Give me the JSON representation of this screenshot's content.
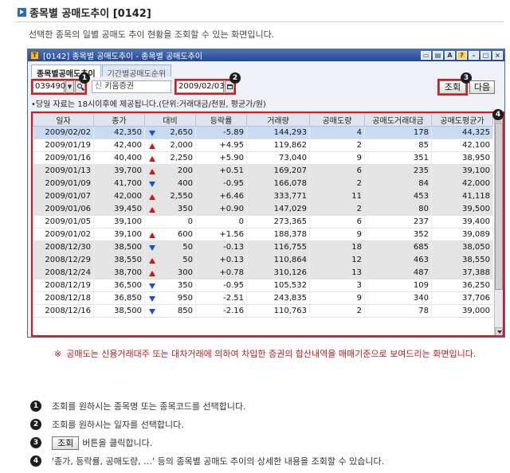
{
  "page": {
    "title": "종목별 공매도추이 [0142]",
    "description": "선택한 종목의 일별 공매도 추이 현황을 조회할 수 있는 화면입니다."
  },
  "window": {
    "app_icon": "T",
    "title": "[0142] 종목별 공매도추이 - 종목별 공매도추이",
    "titlebar_buttons": [
      "window-icon",
      "print-icon",
      "A",
      "?",
      "minimize-icon",
      "maximize-icon",
      "close-icon"
    ]
  },
  "tabs": [
    {
      "label": "종목별공매도추이",
      "active": true
    },
    {
      "label": "기간별공매도순위",
      "active": false
    }
  ],
  "query": {
    "code": "039490",
    "name_prefix": "신",
    "name": "키움증권",
    "date": "2009/02/03",
    "search_label": "조회",
    "next_label": "다음"
  },
  "badges": {
    "b1": "1",
    "b2": "2",
    "b3": "3",
    "b4": "4"
  },
  "notice": "•당일 자료는 18시이후에 제공됩니다.(단위:거래대금/천원, 평균가/원)",
  "table": {
    "headers": [
      "일자",
      "종가",
      "대비",
      "등락률",
      "거래량",
      "공매도량",
      "공매도거래대금",
      "공매도평균가"
    ],
    "rows": [
      {
        "date": "2009/02/02",
        "close": "42,350",
        "dir": "down",
        "change": "2,650",
        "rate": "-5.89",
        "volume": "144,293",
        "short_qty": "4",
        "short_amt": "178",
        "short_avg": "44,325"
      },
      {
        "date": "2009/01/19",
        "close": "42,400",
        "dir": "up",
        "change": "2,000",
        "rate": "+4.95",
        "volume": "119,862",
        "short_qty": "2",
        "short_amt": "85",
        "short_avg": "42,100"
      },
      {
        "date": "2009/01/16",
        "close": "40,400",
        "dir": "up",
        "change": "2,250",
        "rate": "+5.90",
        "volume": "73,040",
        "short_qty": "9",
        "short_amt": "351",
        "short_avg": "38,950"
      },
      {
        "date": "2009/01/13",
        "close": "39,700",
        "dir": "up",
        "change": "200",
        "rate": "+0.51",
        "volume": "169,207",
        "short_qty": "6",
        "short_amt": "235",
        "short_avg": "39,100"
      },
      {
        "date": "2009/01/09",
        "close": "41,700",
        "dir": "down",
        "change": "400",
        "rate": "-0.95",
        "volume": "166,078",
        "short_qty": "2",
        "short_amt": "84",
        "short_avg": "42,000"
      },
      {
        "date": "2009/01/07",
        "close": "42,000",
        "dir": "up",
        "change": "2,550",
        "rate": "+6.46",
        "volume": "333,771",
        "short_qty": "11",
        "short_amt": "453",
        "short_avg": "41,118"
      },
      {
        "date": "2009/01/06",
        "close": "39,450",
        "dir": "up",
        "change": "350",
        "rate": "+0.90",
        "volume": "147,029",
        "short_qty": "2",
        "short_amt": "80",
        "short_avg": "39,500"
      },
      {
        "date": "2009/01/05",
        "close": "39,100",
        "dir": "none",
        "change": "0",
        "rate": "0",
        "volume": "273,365",
        "short_qty": "6",
        "short_amt": "237",
        "short_avg": "39,400"
      },
      {
        "date": "2009/01/02",
        "close": "39,100",
        "dir": "up",
        "change": "600",
        "rate": "+1.56",
        "volume": "188,378",
        "short_qty": "9",
        "short_amt": "352",
        "short_avg": "39,089"
      },
      {
        "date": "2008/12/30",
        "close": "38,500",
        "dir": "down",
        "change": "50",
        "rate": "-0.13",
        "volume": "116,755",
        "short_qty": "18",
        "short_amt": "685",
        "short_avg": "38,050"
      },
      {
        "date": "2008/12/29",
        "close": "38,550",
        "dir": "up",
        "change": "50",
        "rate": "+0.13",
        "volume": "110,864",
        "short_qty": "12",
        "short_amt": "463",
        "short_avg": "38,550"
      },
      {
        "date": "2008/12/24",
        "close": "38,700",
        "dir": "up",
        "change": "300",
        "rate": "+0.78",
        "volume": "310,126",
        "short_qty": "13",
        "short_amt": "487",
        "short_avg": "37,388"
      },
      {
        "date": "2008/12/19",
        "close": "36,500",
        "dir": "down",
        "change": "350",
        "rate": "-0.95",
        "volume": "105,532",
        "short_qty": "3",
        "short_amt": "109",
        "short_avg": "36,250"
      },
      {
        "date": "2008/12/18",
        "close": "36,850",
        "dir": "down",
        "change": "950",
        "rate": "-2.51",
        "volume": "243,835",
        "short_qty": "9",
        "short_amt": "340",
        "short_avg": "37,706"
      },
      {
        "date": "2008/12/16",
        "close": "38,500",
        "dir": "down",
        "change": "850",
        "rate": "-2.16",
        "volume": "110,763",
        "short_qty": "2",
        "short_amt": "78",
        "short_avg": "39,000"
      }
    ]
  },
  "footnote": {
    "mark": "※",
    "text": "공매도는 신용거래대주 또는 대차거래에 의하여 차입한 증권의 합산내역을 매매기준으로 보여드리는 화면입니다."
  },
  "steps": [
    {
      "num": "1",
      "text": "조회를 원하시는 종목명 또는 종목코드를 선택합니다."
    },
    {
      "num": "2",
      "text": "조회를 원하시는 일자를 선택합니다."
    },
    {
      "num": "3",
      "button": "조회",
      "text": "버튼을 클릭합니다."
    },
    {
      "num": "4",
      "text": "'종가, 등락률, 공매도량, …' 등의 종목별 공매도 추이의 상세한 내용을 조회할 수 있습니다."
    }
  ],
  "colors": {
    "highlight": "#e0161b",
    "up": "#d21414",
    "down": "#1b4fc8",
    "titlebar": "#2f56a6"
  }
}
